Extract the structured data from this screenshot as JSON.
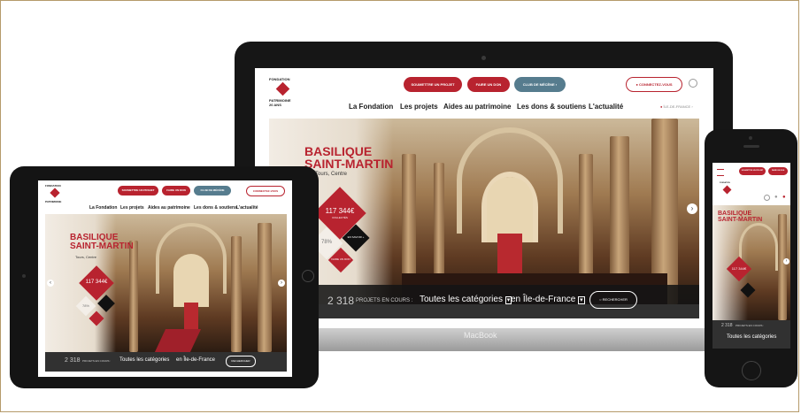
{
  "site": {
    "logo_line1": "FONDATION",
    "logo_line2": "PATRIMOINE",
    "logo_line3": "20 ANS",
    "btn_submit": "SOUMETTRE UN PROJET",
    "btn_donate": "FAIRE UN DON",
    "btn_club": "CLUB DE MÉCÈNE",
    "btn_login": "CONNECTEZ-VOUS",
    "region": "ÎLE-DE-FRANCE",
    "nav": [
      "La Fondation",
      "Les projets",
      "Aides au patrimoine",
      "Les dons & soutiens",
      "L'actualité"
    ]
  },
  "hero": {
    "title": "BASILIQUE\nSAINT-MARTIN",
    "location": "Tours, Centre",
    "amount": "117 344€",
    "amount_label": "COLLECTÉS",
    "percent": "78%",
    "saved_label": "EN SAVOIR +",
    "donate_label": "FAIRE UN DON"
  },
  "search": {
    "count": "2 318",
    "count_label": "PROJETS EN COURS :",
    "category": "Toutes les catégories",
    "region": "en Île-de-France",
    "button": "RECHERCHER"
  },
  "laptop": {
    "brand": "MacBook"
  },
  "colors": {
    "brand_red": "#b8232f",
    "teal": "#567c8e",
    "device_black": "#141414"
  }
}
